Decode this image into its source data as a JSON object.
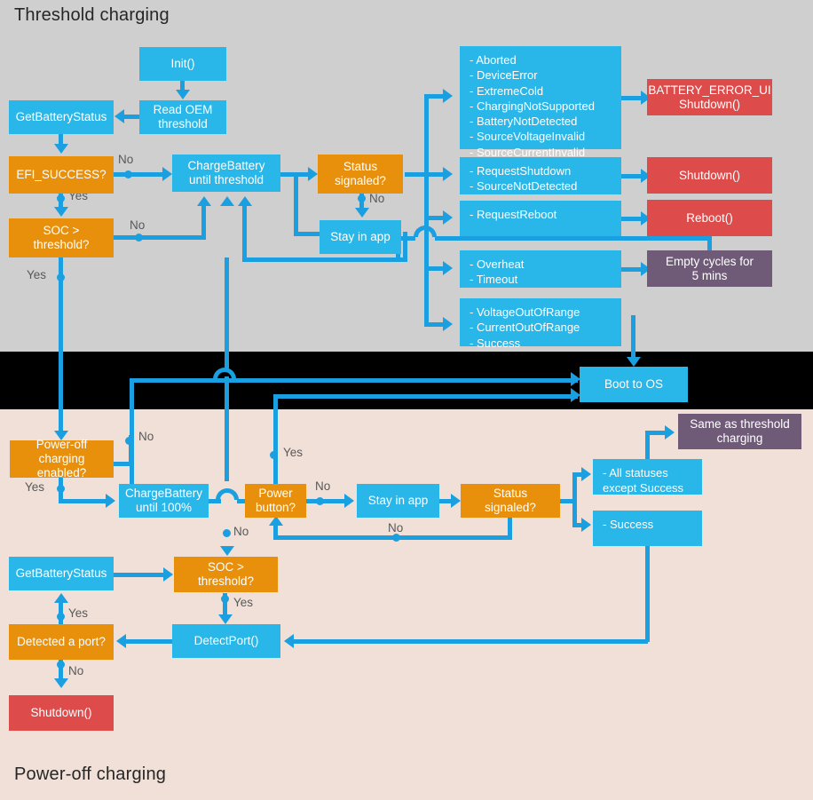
{
  "sections": {
    "top_title": "Threshold charging",
    "bottom_title": "Power-off charging"
  },
  "colors": {
    "blue": "#29b6e8",
    "orange": "#e8900c",
    "red": "#dd4b4b",
    "purple": "#6f5b77",
    "connector": "#1a9fe0",
    "top_background": "#cfcfcf",
    "middle_background": "#000000",
    "bottom_background": "#f0e0d8",
    "label_text": "#595959"
  },
  "threshold": {
    "nodes": {
      "init": "Init()",
      "read_oem_threshold": "Read OEM\nthreshold",
      "get_battery_status": "GetBatteryStatus",
      "efi_success": "EFI_SUCCESS?",
      "soc_threshold": "SOC >\nthreshold?",
      "charge_battery": "ChargeBattery\nuntil threshold",
      "status_signaled": "Status\nsignaled?",
      "stay_in_app": "Stay in app",
      "status_list_errors": "- Aborted\n- DeviceError\n- ExtremeCold\n- ChargingNotSupported\n- BatteryNotDetected\n- SourceVoltageInvalid\n- SourceCurrentInvalid",
      "status_list_shutdown": "- RequestShutdown\n- SourceNotDetected",
      "status_list_reboot": "- RequestReboot",
      "status_list_overheat": "- Overheat\n- Timeout",
      "status_list_success": "- VoltageOutOfRange\n- CurrentOutOfRange\n- Success",
      "battery_error_ui": "BATTERY_ERROR_UI\nShutdown()",
      "shutdown": "Shutdown()",
      "reboot": "Reboot()",
      "empty_cycles": "Empty cycles for\n5 mins"
    },
    "edge_labels": {
      "efi_no": "No",
      "efi_yes": "Yes",
      "soc_no": "No",
      "soc_yes": "Yes",
      "status_no": "No"
    }
  },
  "middle": {
    "boot_to_os": "Boot to OS"
  },
  "poweroff": {
    "nodes": {
      "power_off_enabled": "Power-off\ncharging enabled?",
      "charge_battery_100": "ChargeBattery\nuntil 100%",
      "power_button": "Power\nbutton?",
      "stay_in_app": "Stay in app",
      "status_signaled": "Status\nsignaled?",
      "all_statuses_except_success": "- All statuses\n   except Success",
      "success": "- Success",
      "same_as_threshold": "Same as threshold\ncharging",
      "get_battery_status": "GetBatteryStatus",
      "soc_threshold": "SOC >\nthreshold?",
      "detect_port": "DetectPort()",
      "detected_a_port": "Detected a port?",
      "shutdown": "Shutdown()"
    },
    "edge_labels": {
      "enabled_no": "No",
      "enabled_yes": "Yes",
      "power_button_yes": "Yes",
      "power_button_no": "No",
      "stay_in_app_no": "No",
      "soc_no": "No",
      "soc_yes": "Yes",
      "port_yes": "Yes",
      "port_no": "No"
    }
  }
}
